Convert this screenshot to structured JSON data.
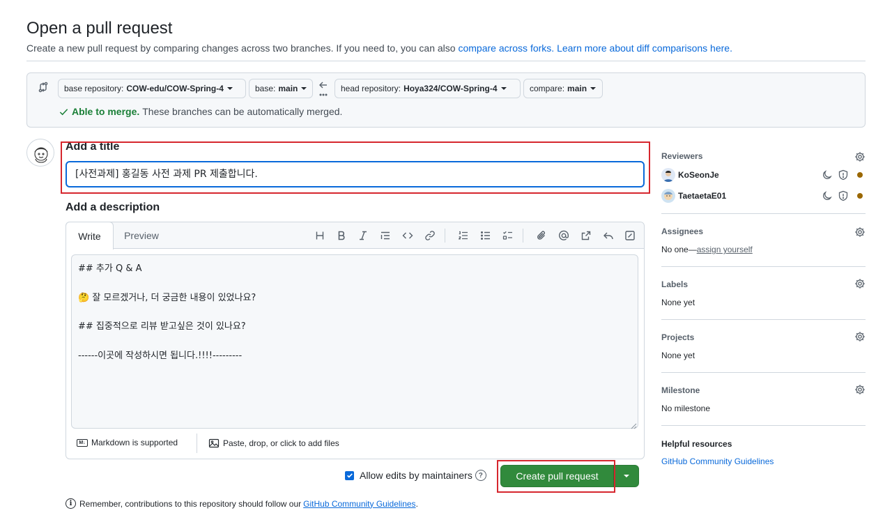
{
  "page": {
    "title": "Open a pull request",
    "subtitle": "Create a new pull request by comparing changes across two branches. If you need to, you can also",
    "compare_forks_link": "compare across forks.",
    "learn_more_link": "Learn more about diff comparisons here."
  },
  "range": {
    "base_repo_prefix": "base repository:",
    "base_repo": "COW-edu/COW-Spring-4",
    "base_prefix": "base:",
    "base": "main",
    "head_repo_prefix": "head repository:",
    "head_repo": "Hoya324/COW-Spring-4",
    "compare_prefix": "compare:",
    "compare": "main",
    "merge_status": "Able to merge.",
    "merge_detail": "These branches can be automatically merged."
  },
  "form": {
    "title_label": "Add a title",
    "title_value": "[사전과제] 홍길동 사전 과제 PR 제출합니다.",
    "description_label": "Add a description",
    "tab_write": "Write",
    "tab_preview": "Preview",
    "body_lines": [
      "## 추가 Q & A",
      "",
      "🤔 잘 모르겠거나, 더 궁금한 내용이 있었나요?",
      "",
      "## 집중적으로 리뷰 받고싶은 것이 있나요?",
      "",
      "------이곳에 작성하시면 됩니다.!!!!---------"
    ],
    "markdown_note": "Markdown is supported",
    "attach_note": "Paste, drop, or click to add files",
    "allow_edits_label": "Allow edits by maintainers",
    "allow_edits_checked": true,
    "create_button": "Create pull request",
    "remember_text": "Remember, contributions to this repository should follow our",
    "guidelines_link": "GitHub Community Guidelines",
    "remember_end": "."
  },
  "sidebar": {
    "reviewers_heading": "Reviewers",
    "reviewers": [
      {
        "name": "KoSeonJe"
      },
      {
        "name": "TaetaetaE01"
      }
    ],
    "assignees_heading": "Assignees",
    "assignees_prefix": "No one—",
    "assign_yourself": "assign yourself",
    "labels_heading": "Labels",
    "labels_value": "None yet",
    "projects_heading": "Projects",
    "projects_value": "None yet",
    "milestone_heading": "Milestone",
    "milestone_value": "No milestone",
    "helpful_heading": "Helpful resources",
    "helpful_link": "GitHub Community Guidelines"
  },
  "colors": {
    "accent": "#0969da",
    "success": "#1a7f37",
    "create_button": "#318a3c",
    "highlight_box": "#d6262d",
    "pending_dot": "#9a6700"
  }
}
